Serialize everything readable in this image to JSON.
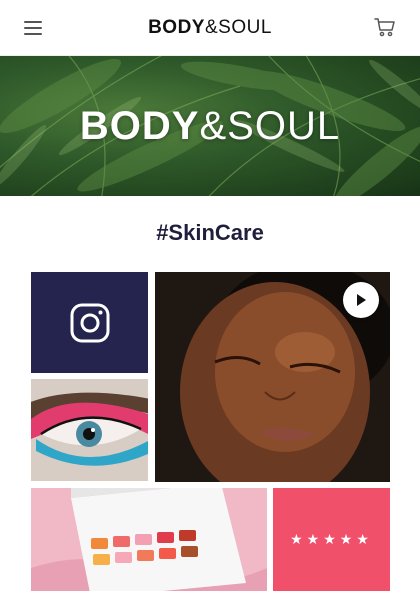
{
  "header": {
    "brand_bold": "BODY",
    "brand_light": "&SOUL",
    "menu_icon": "hamburger-menu-icon",
    "cart_icon": "shopping-cart-icon"
  },
  "hero": {
    "title_bold": "BODY",
    "title_light": "&SOUL"
  },
  "section": {
    "hashtag": "#SkinCare"
  },
  "gallery": {
    "tiles": [
      {
        "name": "instagram-tile",
        "icon": "instagram-icon"
      },
      {
        "name": "eye-makeup-photo"
      },
      {
        "name": "face-portrait-video",
        "icon": "play-icon"
      },
      {
        "name": "eyeshadow-palette-photo"
      },
      {
        "name": "review-tile",
        "stars": "★★★★★",
        "rating": 5
      }
    ]
  },
  "colors": {
    "brand_text": "#1f1f3d",
    "instagram_bg": "#24244e",
    "review_bg": "#f0506a",
    "palette_bg": "#f3c6cf"
  }
}
